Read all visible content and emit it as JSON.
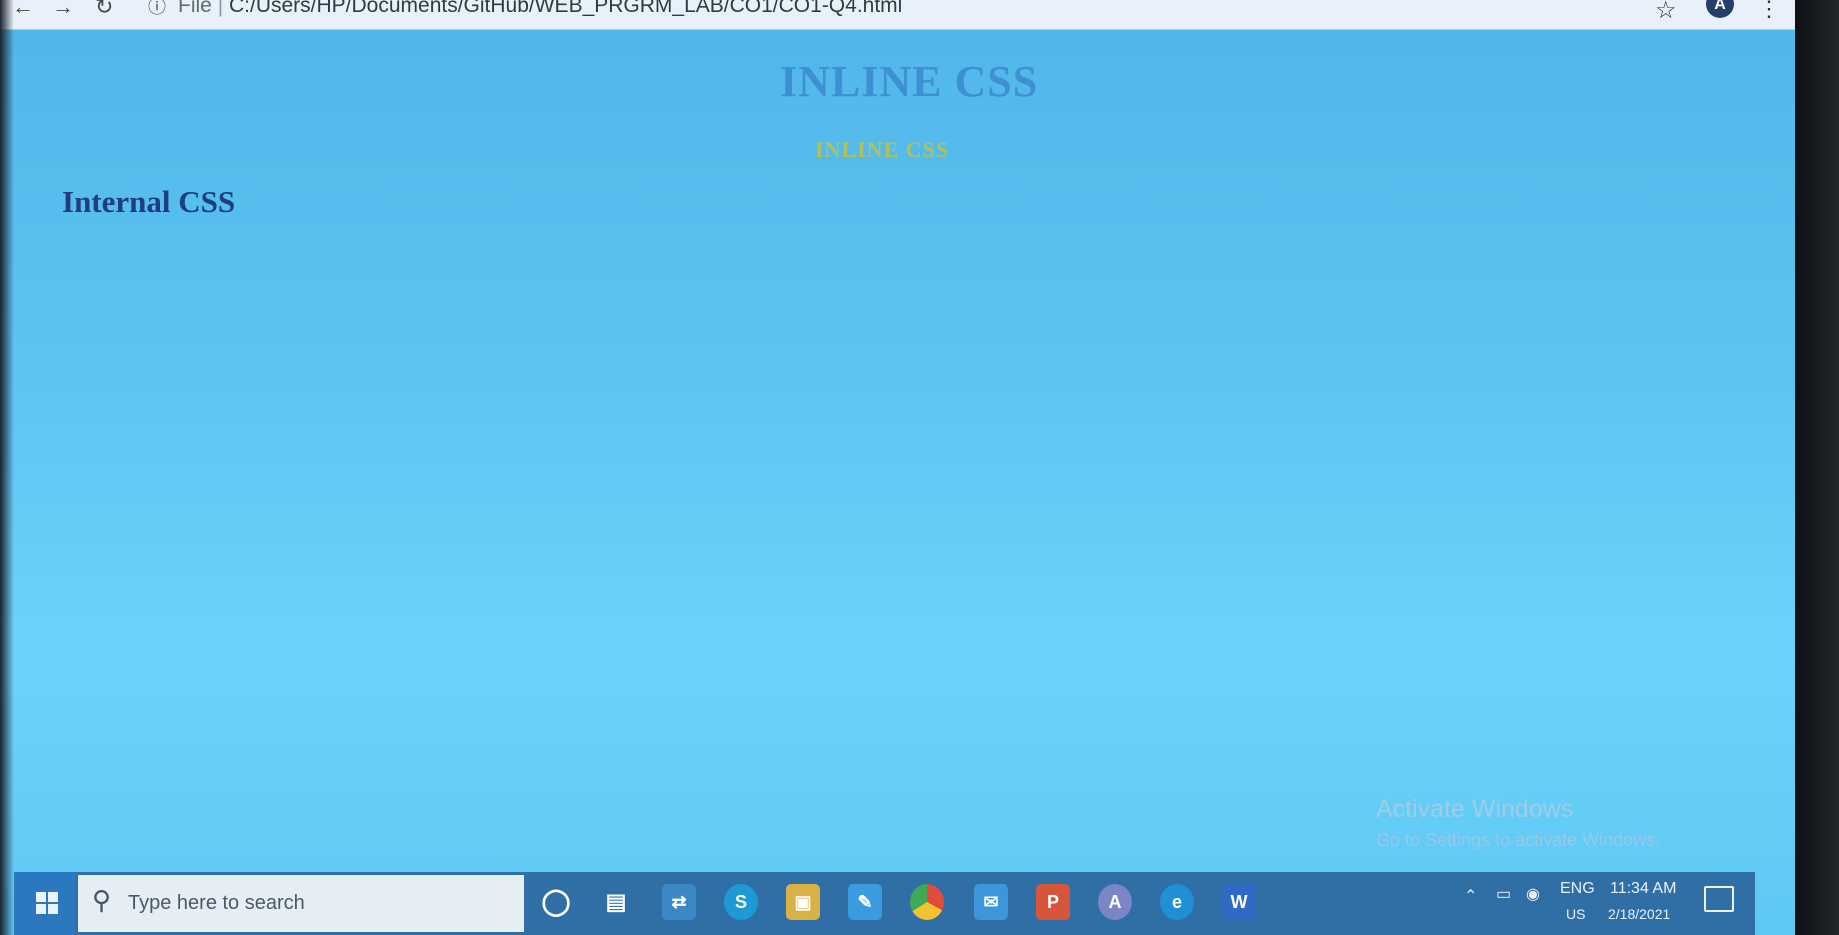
{
  "browser": {
    "url_prefix": "File",
    "url_path": "C:/Users/HP/Documents/GitHub/WEB_PRGRM_LAB/CO1/CO1-Q4.html",
    "profile_initial": "A"
  },
  "page": {
    "heading": "INLINE CSS",
    "subheading": "INLINE CSS",
    "internal_heading": "Internal CSS"
  },
  "watermark": {
    "title": "Activate Windows",
    "subtitle": "Go to Settings to activate Windows."
  },
  "taskbar": {
    "search_placeholder": "Type here to search",
    "language": "ENG",
    "region": "US",
    "time": "11:34 AM",
    "date": "2/18/2021",
    "apps": [
      "cortana-icon",
      "task-view-icon",
      "file-share-icon",
      "skype-icon",
      "file-explorer-icon",
      "notes-icon",
      "chrome-icon",
      "mail-icon",
      "powerpoint-icon",
      "paint-icon",
      "edge-icon",
      "word-icon"
    ]
  },
  "colors": {
    "screen_bg": "#5cc4f2",
    "heading": "#3f8fd3",
    "subheading": "#b3c15b",
    "internal_heading": "#1e3d82",
    "taskbar": "#2f6fa6"
  }
}
